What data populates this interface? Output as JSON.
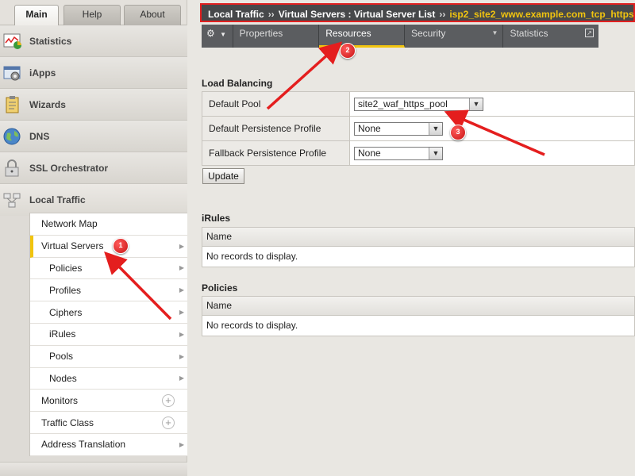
{
  "top_tabs": [
    {
      "label": "Main",
      "active": true
    },
    {
      "label": "Help",
      "active": false
    },
    {
      "label": "About",
      "active": false
    }
  ],
  "sections": [
    {
      "label": "Statistics",
      "icon": "chart-icon"
    },
    {
      "label": "iApps",
      "icon": "gear-window-icon"
    },
    {
      "label": "Wizards",
      "icon": "clipboard-icon"
    },
    {
      "label": "DNS",
      "icon": "globe-icon"
    },
    {
      "label": "SSL Orchestrator",
      "icon": "lock-icon"
    },
    {
      "label": "Local Traffic",
      "icon": "network-icon"
    }
  ],
  "subnav": [
    {
      "label": "Network Map"
    },
    {
      "label": "Virtual Servers"
    },
    {
      "label": "Policies"
    },
    {
      "label": "Profiles"
    },
    {
      "label": "Ciphers"
    },
    {
      "label": "iRules"
    },
    {
      "label": "Pools"
    },
    {
      "label": "Nodes"
    },
    {
      "label": "Monitors"
    },
    {
      "label": "Traffic Class"
    },
    {
      "label": "Address Translation"
    }
  ],
  "breadcrumb": {
    "part1": "Local Traffic",
    "sep": "››",
    "part2": "Virtual Servers : Virtual Server List",
    "current": "isp2_site2_www.example.com_tcp_https"
  },
  "tabs": {
    "properties": "Properties",
    "resources": "Resources",
    "security": "Security",
    "statistics": "Statistics"
  },
  "load_balancing": {
    "heading": "Load Balancing",
    "default_pool_label": "Default Pool",
    "default_pool_value": "site2_waf_https_pool",
    "default_persistence_label": "Default Persistence Profile",
    "default_persistence_value": "None",
    "fallback_persistence_label": "Fallback Persistence Profile",
    "fallback_persistence_value": "None",
    "update_label": "Update"
  },
  "irules": {
    "heading": "iRules",
    "column": "Name",
    "empty": "No records to display."
  },
  "policies": {
    "heading": "Policies",
    "column": "Name",
    "empty": "No records to display."
  },
  "annotations": {
    "badge1": "1",
    "badge2": "2",
    "badge3": "3"
  },
  "colors": {
    "highlight": "#e02020",
    "accent": "#f1c40f"
  }
}
